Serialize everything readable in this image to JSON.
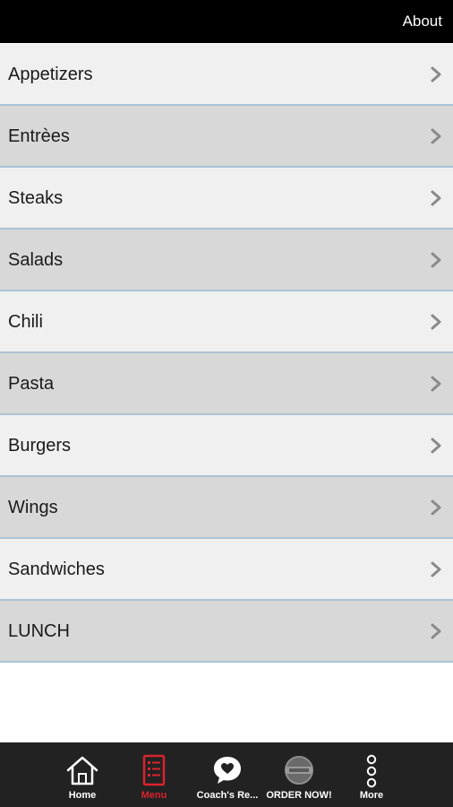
{
  "header": {
    "about_label": "About"
  },
  "menu": {
    "items": [
      {
        "label": "Appetizers"
      },
      {
        "label": "Entrèes"
      },
      {
        "label": "Steaks"
      },
      {
        "label": "Salads"
      },
      {
        "label": "Chili"
      },
      {
        "label": "Pasta"
      },
      {
        "label": "Burgers"
      },
      {
        "label": "Wings"
      },
      {
        "label": "Sandwiches"
      },
      {
        "label": "LUNCH"
      }
    ]
  },
  "tabbar": {
    "tabs": [
      {
        "label": "Home",
        "icon": "home-icon"
      },
      {
        "label": "Menu",
        "icon": "menu-list-icon",
        "active": true
      },
      {
        "label": "Coach's Re...",
        "icon": "heart-chat-icon"
      },
      {
        "label": "ORDER NOW!",
        "icon": "logo-badge-icon"
      },
      {
        "label": "More",
        "icon": "more-vertical-icon"
      }
    ]
  },
  "colors": {
    "header_bg": "#000000",
    "row_light": "#f0f0f0",
    "row_dark": "#d8d8d8",
    "row_divider": "#a9c3d6",
    "tabbar_bg": "#222222",
    "active_tab": "#d9232e"
  }
}
